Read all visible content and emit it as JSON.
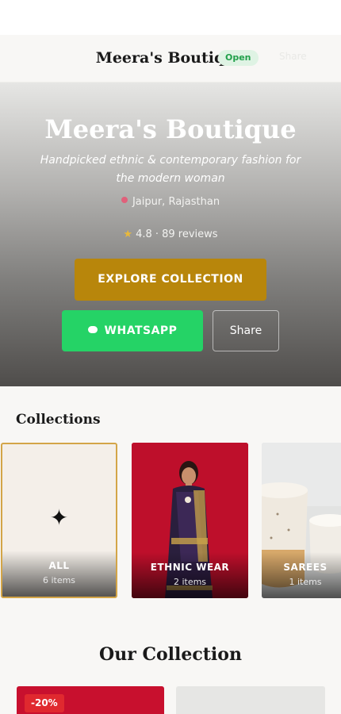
{
  "header": {
    "brand": "Meera's Boutique",
    "status": "Open",
    "ghost_label": "Share"
  },
  "hero": {
    "title": "Meera's Boutique",
    "tagline": "Handpicked ethnic & contemporary fashion for the modern woman",
    "location": "Jaipur, Rajasthan",
    "rating": "4.8 · 89 reviews",
    "explore_label": "EXPLORE COLLECTION",
    "whatsapp_label": "WHATSAPP",
    "share_label": "Share"
  },
  "collections": {
    "title": "Collections",
    "items": [
      {
        "name": "ALL",
        "count": "6 items",
        "icon": "sparkle-icon"
      },
      {
        "name": "ETHNIC WEAR",
        "count": "2 items",
        "icon": "saree-model-photo"
      },
      {
        "name": "SAREES",
        "count": "1 items",
        "icon": "ceramic-bowls-photo"
      }
    ]
  },
  "products": {
    "title": "Our Collection",
    "items": [
      {
        "badge": "-20%"
      },
      {
        "badge": ""
      }
    ]
  },
  "colors": {
    "accent": "#b8860b",
    "whatsapp": "#25d366",
    "status_bg": "#dff3e4",
    "status_text": "#22a04b",
    "discount": "#e0292f"
  }
}
